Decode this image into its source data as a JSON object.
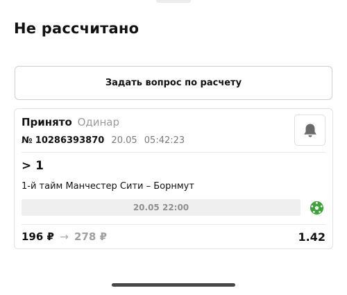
{
  "header": {
    "title": "Не рассчитано"
  },
  "actions": {
    "ask_label": "Задать вопрос по расчету"
  },
  "bet": {
    "status": "Принято",
    "type": "Одинар",
    "number_prefix": "№",
    "number": "10286393870",
    "date": "20.05",
    "time": "05:42:23",
    "outcome": "> 1",
    "event": "1-й тайм Манчестер Сити – Борнмут",
    "event_datetime": "20.05 22:00",
    "stake": "196 ₽",
    "arrow": "→",
    "payout": "278 ₽",
    "odds": "1.42"
  },
  "icons": {
    "bell": "bell-icon",
    "sport": "soccer-ball-icon"
  },
  "colors": {
    "text": "#111111",
    "muted": "#9a9a9a",
    "sport_icon": "#3aa635",
    "border": "#e2e2e2"
  }
}
